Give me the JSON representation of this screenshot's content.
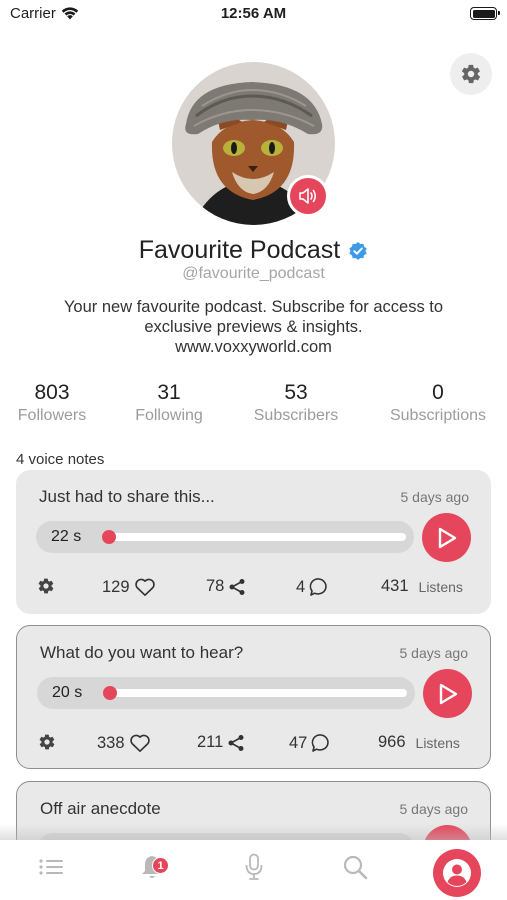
{
  "status_bar": {
    "carrier": "Carrier",
    "time": "12:56 AM"
  },
  "profile": {
    "name": "Favourite Podcast",
    "handle": "@favourite_podcast",
    "bio_lines": [
      "Your new favourite podcast. Subscribe for access to",
      "exclusive previews & insights.",
      "www.voxxyworld.com"
    ],
    "stats": [
      {
        "value": "803",
        "label": "Followers"
      },
      {
        "value": "31",
        "label": "Following"
      },
      {
        "value": "53",
        "label": "Subscribers"
      },
      {
        "value": "0",
        "label": "Subscriptions"
      }
    ]
  },
  "feed": {
    "count_label": "4 voice notes",
    "notes": [
      {
        "title": "Just had to share this...",
        "date": "5 days ago",
        "duration": "22 s",
        "likes": "129",
        "shares": "78",
        "comments": "4",
        "listens": "431",
        "listens_label": "Listens",
        "progress": 0
      },
      {
        "title": "What do you want to hear?",
        "date": "5 days ago",
        "duration": "20 s",
        "likes": "338",
        "shares": "211",
        "comments": "47",
        "listens": "966",
        "listens_label": "Listens",
        "progress": 0
      },
      {
        "title": "Off air anecdote",
        "date": "5 days ago"
      }
    ]
  },
  "tab_bar": {
    "items": [
      "feed-list-icon",
      "notifications-bell-icon",
      "microphone-icon",
      "search-icon",
      "profile-icon"
    ],
    "notification_count": "1",
    "active": "profile-icon"
  },
  "colors": {
    "accent": "#e6465b",
    "verified": "#3d9ae8",
    "card_bg": "#e9e9e9"
  }
}
